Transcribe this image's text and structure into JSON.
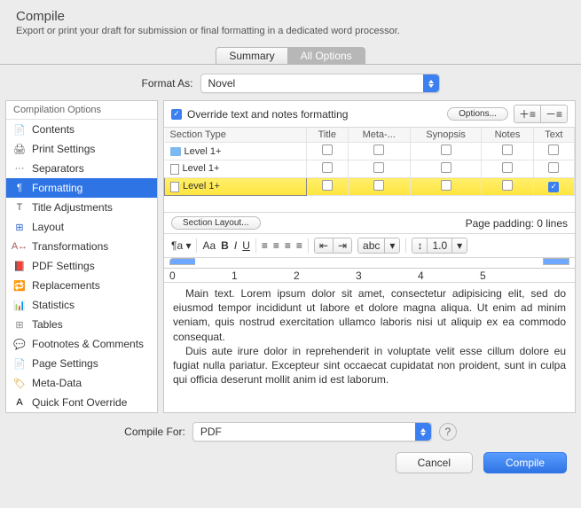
{
  "header": {
    "title": "Compile",
    "subtitle": "Export or print your draft for submission or final formatting in a dedicated word processor."
  },
  "tabs": {
    "summary": "Summary",
    "all": "All Options"
  },
  "format": {
    "label": "Format As:",
    "value": "Novel"
  },
  "sidebar": {
    "heading": "Compilation Options",
    "items": [
      "Contents",
      "Print Settings",
      "Separators",
      "Formatting",
      "Title Adjustments",
      "Layout",
      "Transformations",
      "PDF Settings",
      "Replacements",
      "Statistics",
      "Tables",
      "Footnotes & Comments",
      "Page Settings",
      "Meta-Data",
      "Quick Font Override"
    ]
  },
  "override": {
    "label": "Override text and notes formatting",
    "options": "Options..."
  },
  "columns": [
    "Section Type",
    "Title",
    "Meta-...",
    "Synopsis",
    "Notes",
    "Text"
  ],
  "rows": [
    {
      "label": "Level  1+",
      "icon": "folder",
      "checks": [
        false,
        false,
        false,
        false,
        false
      ]
    },
    {
      "label": "Level  1+",
      "icon": "doc",
      "checks": [
        false,
        false,
        false,
        false,
        false
      ]
    },
    {
      "label": "Level  1+",
      "icon": "doc",
      "checks": [
        false,
        false,
        false,
        false,
        true
      ],
      "hl": true
    }
  ],
  "section_layout": "Section Layout...",
  "page_padding": "Page padding: 0 lines",
  "preview": {
    "p1": "Main text. Lorem ipsum dolor sit amet, consectetur adipisicing elit, sed do eiusmod tempor incididunt ut labore et dolore magna aliqua. Ut enim ad minim veniam, quis nostrud exercitation ullamco laboris nisi ut aliquip ex ea commodo consequat.",
    "p2": "Duis aute irure dolor in reprehenderit in voluptate velit esse cillum dolore eu fugiat nulla pariatur. Excepteur sint occaecat cupidatat non proident, sunt in culpa qui officia deserunt mollit anim id est laborum."
  },
  "compile_for": {
    "label": "Compile For:",
    "value": "PDF"
  },
  "buttons": {
    "cancel": "Cancel",
    "compile": "Compile"
  },
  "ruler": {
    "marks": [
      "0",
      "1",
      "2",
      "3",
      "4",
      "5"
    ]
  },
  "toolbar": {
    "linespacing": "1.0",
    "liststyle": "abc"
  }
}
